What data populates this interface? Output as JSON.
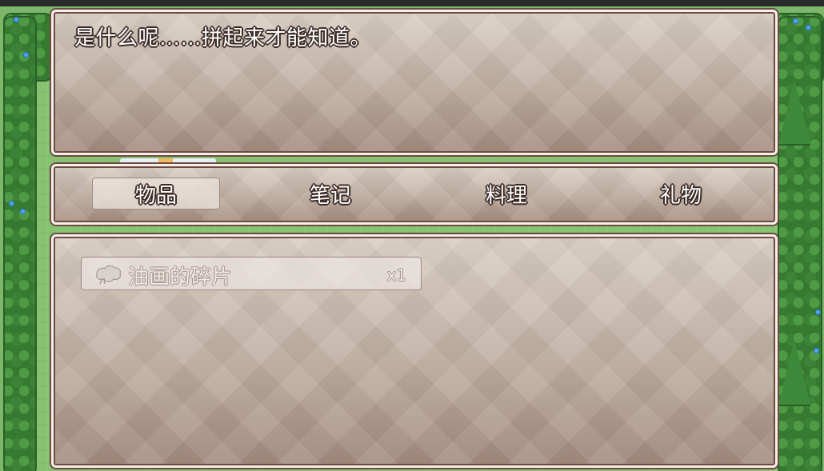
{
  "message": {
    "text": "是什么呢……拼起来才能知道。"
  },
  "tabs": [
    {
      "label": "物品",
      "selected": true
    },
    {
      "label": "笔记",
      "selected": false
    },
    {
      "label": "料理",
      "selected": false
    },
    {
      "label": "礼物",
      "selected": false
    }
  ],
  "items": [
    {
      "icon": "painting-fragment-icon",
      "name": "油画的碎片",
      "count": "x1",
      "enabled": false
    }
  ],
  "colors": {
    "window_top": "#d9cfc4",
    "window_bottom": "#a48b7e",
    "window_border": "#6e4b42",
    "text": "#ffffff",
    "grass": "#86c272",
    "hedge": "#367a31"
  }
}
